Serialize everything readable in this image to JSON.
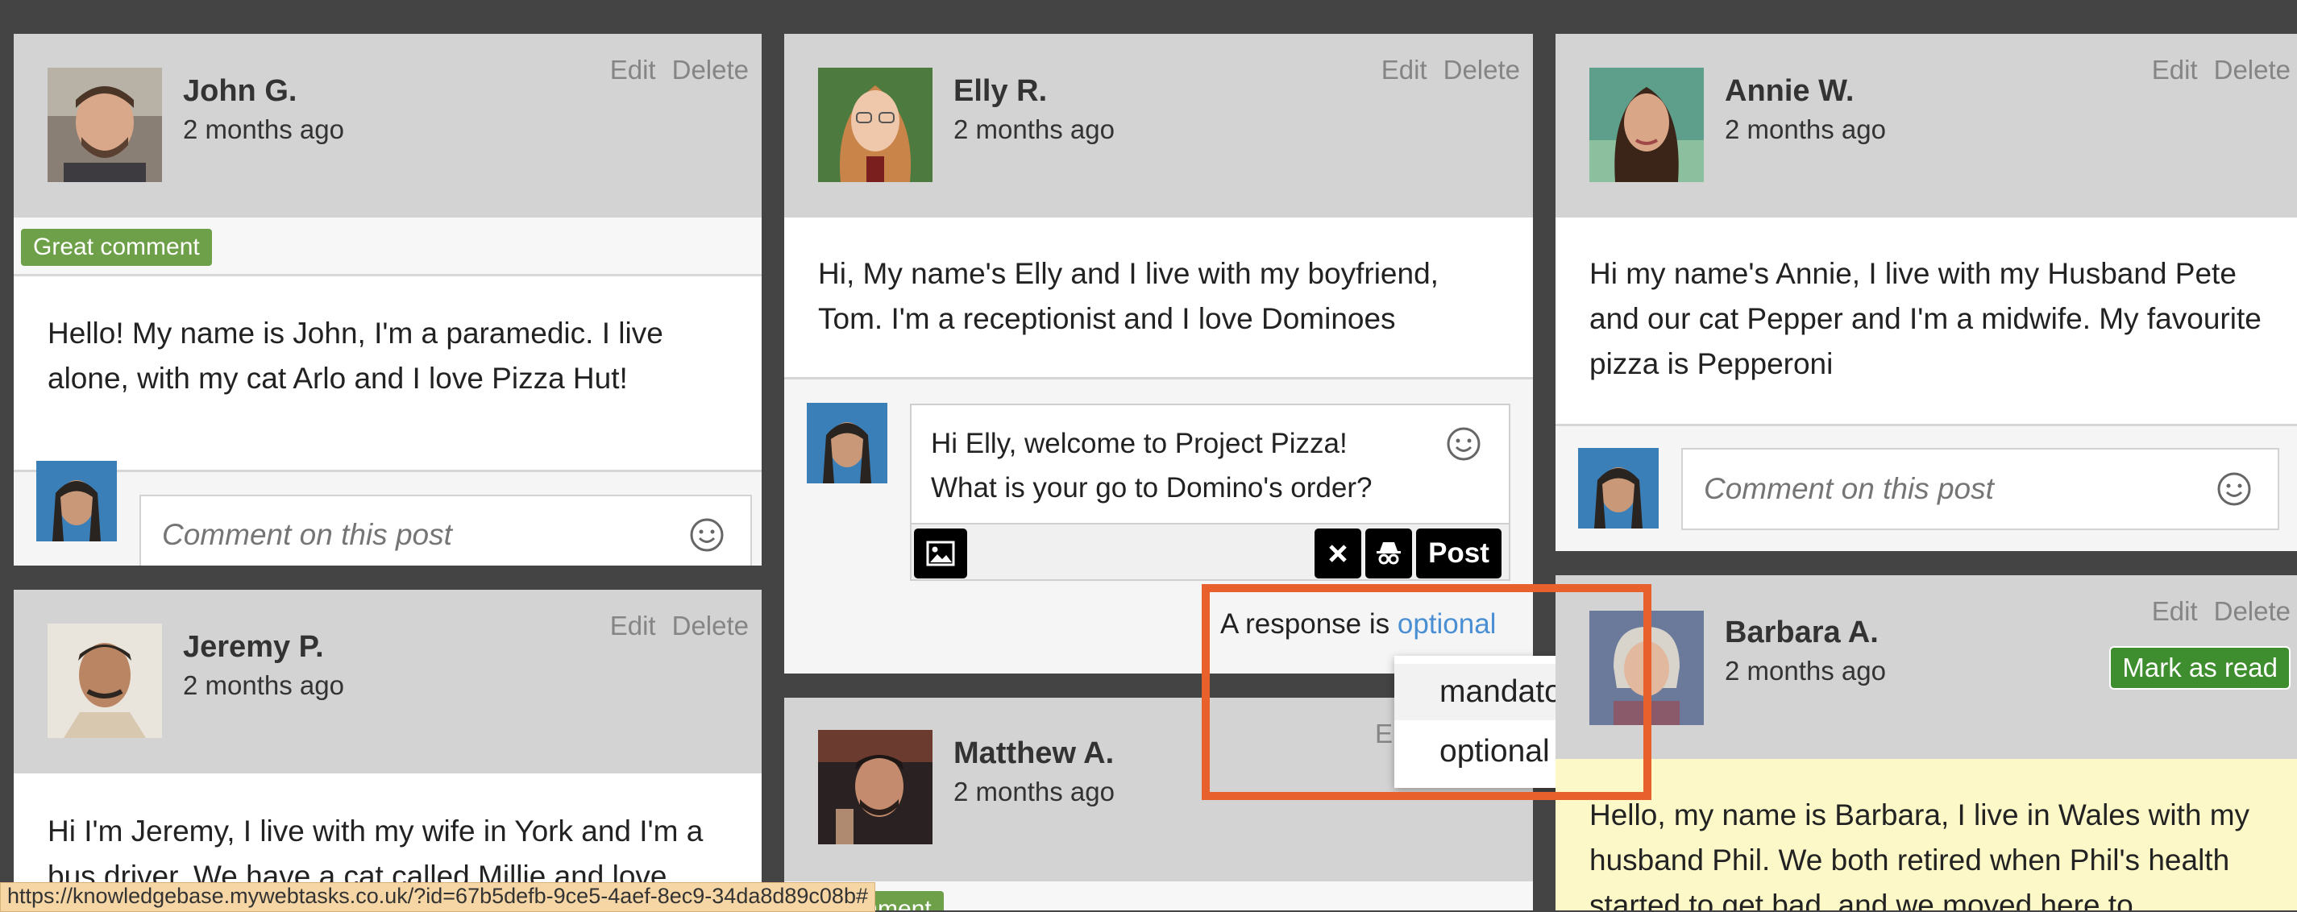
{
  "post_actions": {
    "edit": "Edit",
    "delete": "Delete"
  },
  "comment_placeholder": "Comment on this post",
  "posts": {
    "john": {
      "author": "John G.",
      "time": "2 months ago",
      "badge": "Great comment",
      "body": "Hello! My name is John, I'm a paramedic. I live alone, with my cat Arlo and I love Pizza Hut!"
    },
    "jeremy": {
      "author": "Jeremy P.",
      "time": "2 months ago",
      "body": "Hi I'm Jeremy, I live with my wife in York and I'm a bus driver. We have a cat called Millie and love"
    },
    "elly": {
      "author": "Elly R.",
      "time": "2 months ago",
      "body": "Hi, My name's Elly and I live with my boyfriend, Tom. I'm a receptionist and I love Dominoes",
      "reply_draft": "Hi Elly, welcome to Project Pizza! What is your go to Domino's order?",
      "post_button": "Post",
      "response_prefix": "A response is",
      "response_value": "optional",
      "response_options": [
        "mandatory",
        "optional"
      ]
    },
    "matthew": {
      "author": "Matthew A.",
      "time": "2 months ago",
      "actions_partial": "E",
      "badge_partial": "at comment"
    },
    "annie": {
      "author": "Annie W.",
      "time": "2 months ago",
      "body": "Hi my name's Annie, I live with my Husband Pete and our cat Pepper and I'm a midwife. My favourite pizza is Pepperoni"
    },
    "barbara": {
      "author": "Barbara A.",
      "time": "2 months ago",
      "mark_read": "Mark as read",
      "body": "Hello, my name is Barbara, I live in Wales with my husband Phil. We both retired when Phil's health started to get bad, and we moved here to"
    }
  },
  "status_url": "https://knowledgebase.mywebtasks.co.uk/?id=67b5defb-9ce5-4aef-8ec9-34da8d89c08b#",
  "colors": {
    "background": "#444444",
    "header": "#d3d3d3",
    "badge_green": "#6ea049",
    "mark_read_green": "#3e8e2f",
    "link_blue": "#4a8fd4",
    "highlight_orange": "#e8612c",
    "barbara_body": "#fdf8c8"
  }
}
